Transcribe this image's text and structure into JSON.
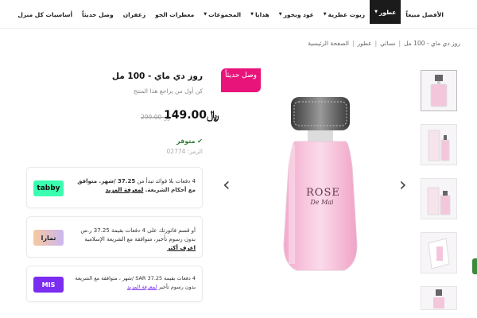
{
  "nav": {
    "items": [
      {
        "label": "الأفضل مبيعاً",
        "chevron": false,
        "active": false
      },
      {
        "label": "عطور",
        "chevron": true,
        "active": true
      },
      {
        "label": "زيوت عطرية",
        "chevron": true,
        "active": false
      },
      {
        "label": "عود وبخور",
        "chevron": true,
        "active": false
      },
      {
        "label": "هدايا",
        "chevron": true,
        "active": false
      },
      {
        "label": "المجموعات",
        "chevron": true,
        "active": false
      },
      {
        "label": "معطرات الجو",
        "chevron": false,
        "active": false
      },
      {
        "label": "زعفران",
        "chevron": false,
        "active": false
      },
      {
        "label": "وصل حديثاً",
        "chevron": false,
        "active": false
      },
      {
        "label": "أساسيات كل منزل",
        "chevron": false,
        "active": false
      }
    ]
  },
  "breadcrumb": {
    "items": [
      "الصفحة الرئيسية",
      "عطور",
      "نسائي",
      "روز دي ماي - 100 مل"
    ],
    "separator": "|"
  },
  "product": {
    "title": "روز دي ماي - 100 مل",
    "first_review": "كن أول من يراجع هذا المنتج",
    "badge": "وصل حديثاً",
    "old_price": "299.00",
    "price": "149.00",
    "currency": "﷼",
    "stock": "متوفر",
    "code_label": "الرمز: 02774",
    "bottle_brand": "ROSE",
    "bottle_sub": "De Mai"
  },
  "payments": {
    "tabby": {
      "text_a": "4 دفعات بلا فوائد تبدأ من ",
      "amount": "37.25",
      "text_b": " /شهر. متوافق مع أحكام الشريعة. ",
      "link": "لمعرفة المزيد",
      "logo": "tabby"
    },
    "tamara": {
      "text": "أو قسم فاتورتك على 4 دفعات بقيمة 37.25 ر.س بدون رسوم تأخير، متوافقة مع الشريعة الإسلامية ",
      "link": "اعرف أكثر",
      "logo": "تمارا"
    },
    "mis": {
      "text": "4 دفعات بقيمة SAR 37.25 /شهر ، متوافقة مع الشريعة بدون رسوم تأخير ",
      "link": "لمعرفة المزيد",
      "logo": "MIS"
    }
  },
  "colors": {
    "accent": "#e8147a",
    "nav_active": "#1b1b1b",
    "stock": "#2e7d32",
    "tabby": "#3bffb0",
    "mis": "#7a2cf0"
  }
}
